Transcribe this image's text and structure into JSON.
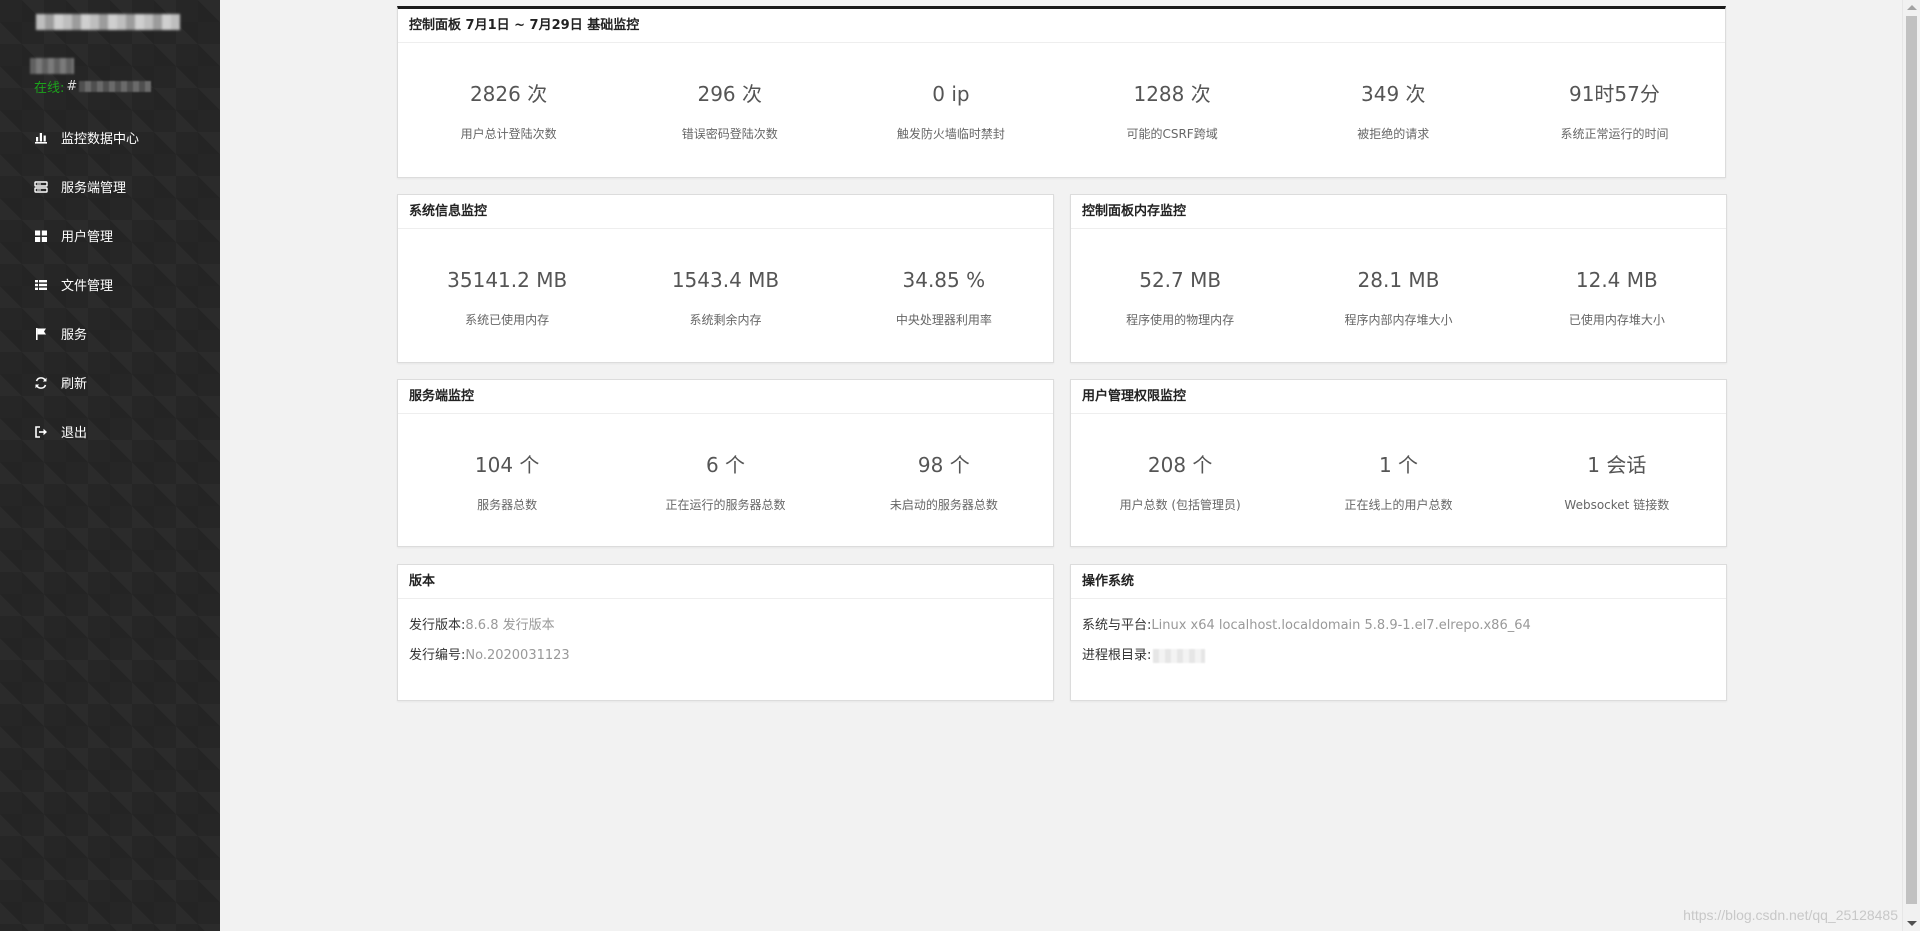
{
  "sidebar": {
    "online_label": "在线:",
    "online_prefix": "#",
    "nav": [
      {
        "label": "监控数据中心",
        "icon": "bar-chart-icon"
      },
      {
        "label": "服务端管理",
        "icon": "server-icon"
      },
      {
        "label": "用户管理",
        "icon": "grid-icon"
      },
      {
        "label": "文件管理",
        "icon": "list-icon"
      },
      {
        "label": "服务",
        "icon": "flag-icon"
      },
      {
        "label": "刷新",
        "icon": "refresh-icon"
      },
      {
        "label": "退出",
        "icon": "sign-out-icon"
      }
    ]
  },
  "basic": {
    "title": "控制面板 7月1日 ~ 7月29日 基础监控",
    "stats": [
      {
        "value": "2826 次",
        "label": "用户总计登陆次数"
      },
      {
        "value": "296 次",
        "label": "错误密码登陆次数"
      },
      {
        "value": "0 ip",
        "label": "触发防火墙临时禁封"
      },
      {
        "value": "1288 次",
        "label": "可能的CSRF跨域"
      },
      {
        "value": "349 次",
        "label": "被拒绝的请求"
      },
      {
        "value": "91时57分",
        "label": "系统正常运行的时间"
      }
    ]
  },
  "system": {
    "title": "系统信息监控",
    "stats": [
      {
        "value": "35141.2 MB",
        "label": "系统已使用内存"
      },
      {
        "value": "1543.4 MB",
        "label": "系统剩余内存"
      },
      {
        "value": "34.85 %",
        "label": "中央处理器利用率"
      }
    ]
  },
  "memory": {
    "title": "控制面板内存监控",
    "stats": [
      {
        "value": "52.7 MB",
        "label": "程序使用的物理内存"
      },
      {
        "value": "28.1 MB",
        "label": "程序内部内存堆大小"
      },
      {
        "value": "12.4 MB",
        "label": "已使用内存堆大小"
      }
    ]
  },
  "servers": {
    "title": "服务端监控",
    "stats": [
      {
        "value": "104 个",
        "label": "服务器总数"
      },
      {
        "value": "6 个",
        "label": "正在运行的服务器总数"
      },
      {
        "value": "98 个",
        "label": "未启动的服务器总数"
      }
    ]
  },
  "users": {
    "title": "用户管理权限监控",
    "stats": [
      {
        "value": "208 个",
        "label": "用户总数 (包括管理员)"
      },
      {
        "value": "1 个",
        "label": "正在线上的用户总数"
      },
      {
        "value": "1 会话",
        "label": "Websocket 链接数"
      }
    ]
  },
  "version": {
    "title": "版本",
    "release_key": "发行版本:",
    "release_value": "8.6.8 发行版本",
    "build_key": "发行编号:",
    "build_value": "No.2020031123"
  },
  "os": {
    "title": "操作系统",
    "platform_key": "系统与平台:",
    "platform_value": "Linux x64 localhost.localdomain 5.8.9-1.el7.elrepo.x86_64",
    "root_key": "进程根目录:"
  },
  "watermark": "https://blog.csdn.net/qq_25128485"
}
